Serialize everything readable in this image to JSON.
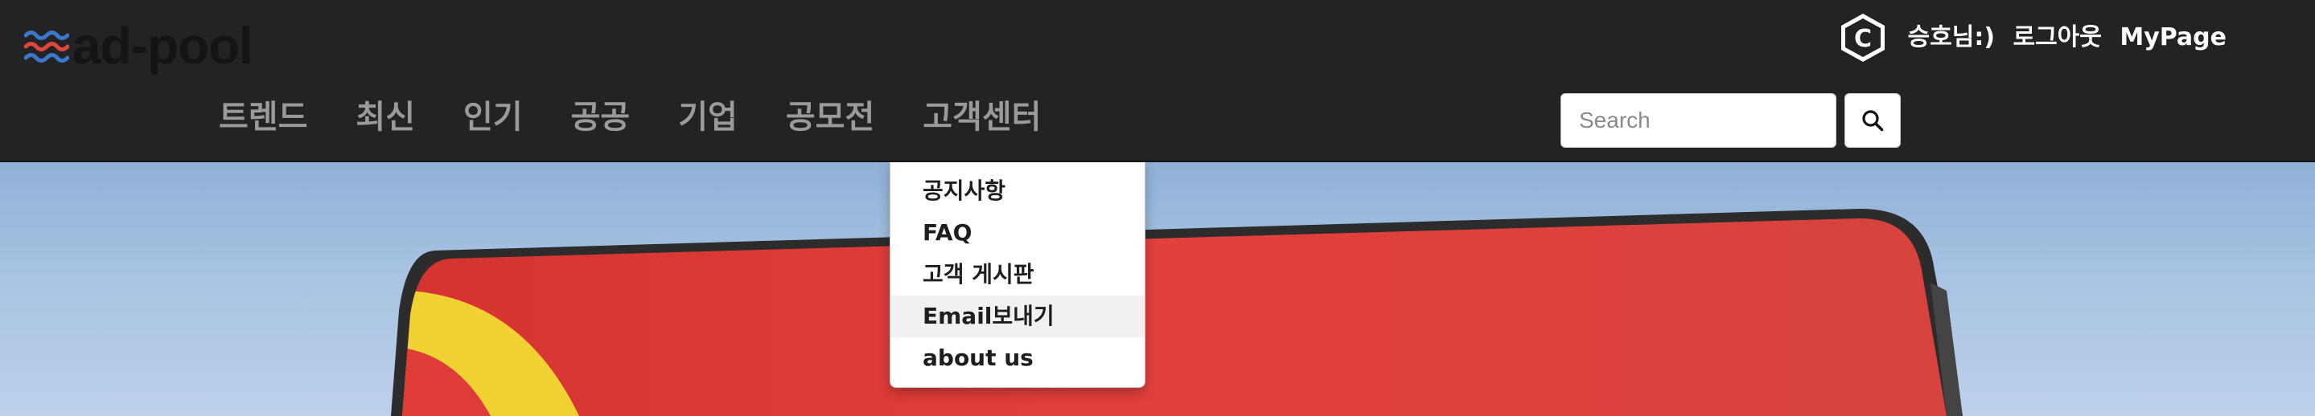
{
  "brand": {
    "logo_text": "ad-pool",
    "wave_colors": [
      "#3a78c9",
      "#e0473c",
      "#3a78c9"
    ]
  },
  "user": {
    "avatar_letter": "C",
    "greeting": "승호님:)",
    "logout_label": "로그아웃",
    "mypage_label": "MyPage"
  },
  "nav": {
    "menu": [
      {
        "label": "트렌드"
      },
      {
        "label": "최신"
      },
      {
        "label": "인기"
      },
      {
        "label": "공공"
      },
      {
        "label": "기업"
      },
      {
        "label": "공모전"
      },
      {
        "label": "고객센터"
      }
    ]
  },
  "search": {
    "placeholder": "Search",
    "value": "",
    "icon": "search-icon"
  },
  "dropdown": {
    "parent": "고객센터",
    "items": [
      {
        "label": "공지사항"
      },
      {
        "label": "FAQ"
      },
      {
        "label": "고객 게시판"
      },
      {
        "label": "Email보내기",
        "hovered": true
      },
      {
        "label": "about us"
      }
    ]
  },
  "colors": {
    "navbar_bg": "#232323",
    "menu_text": "#9a9a9a",
    "billboard_red": "#df3b37",
    "billboard_yellow": "#f2d232"
  }
}
